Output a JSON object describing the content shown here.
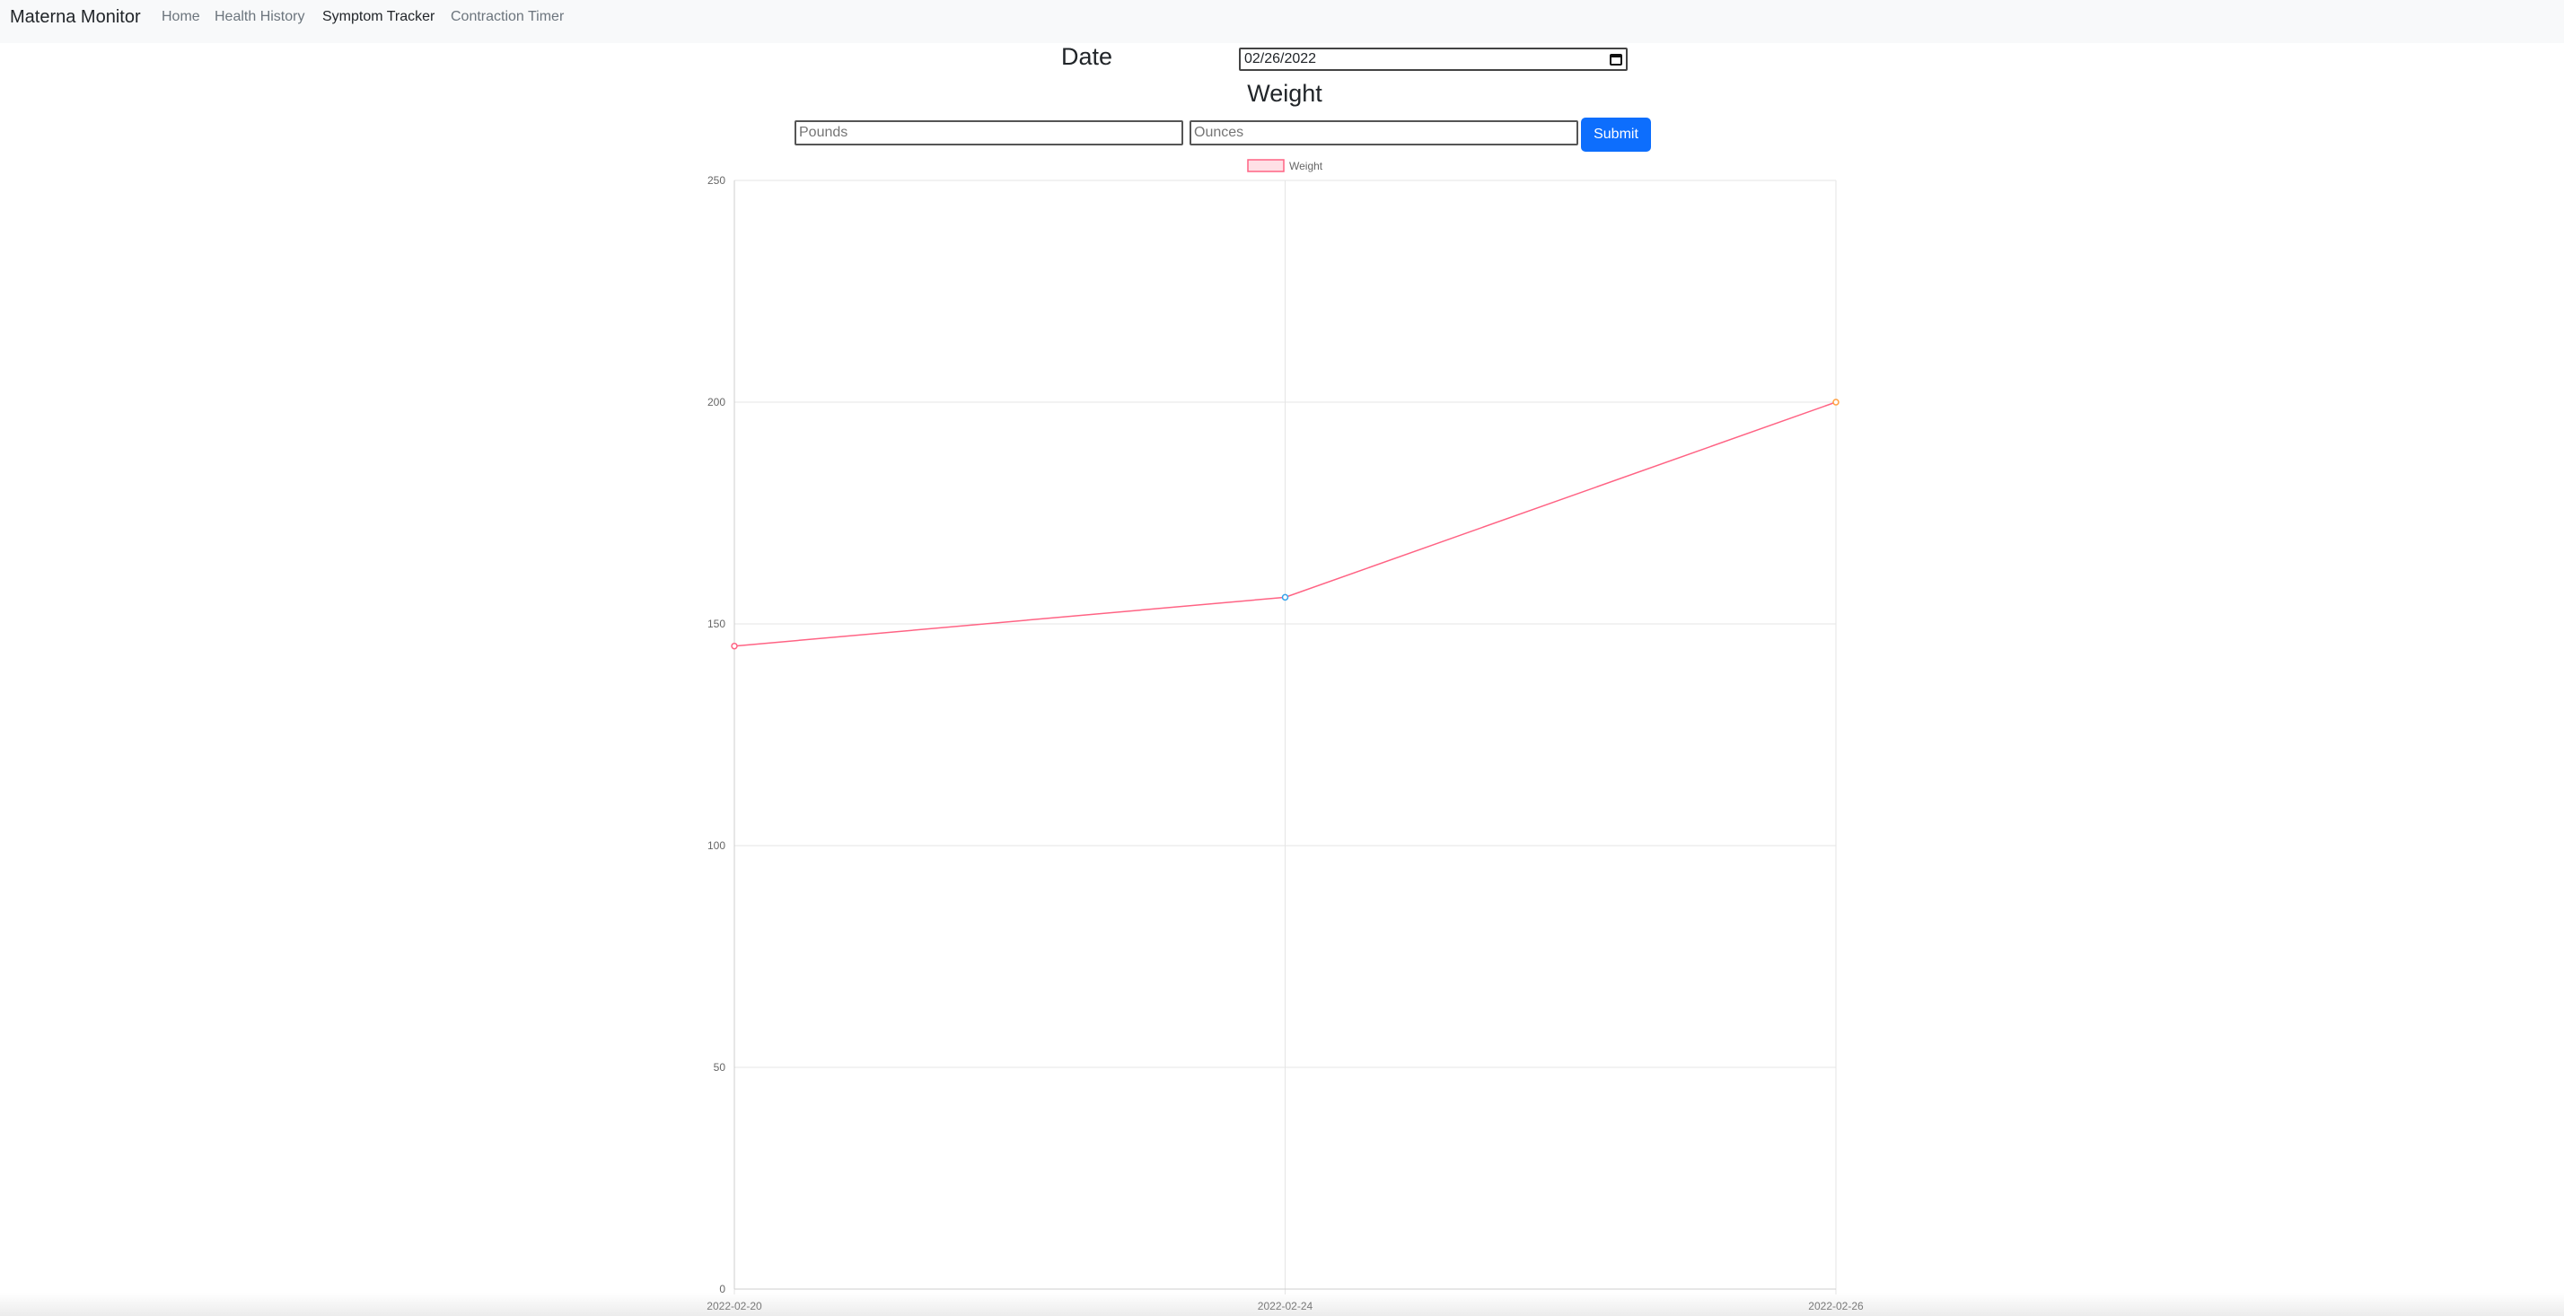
{
  "navbar": {
    "brand": "Materna Monitor",
    "links": [
      {
        "label": "Home",
        "active": false
      },
      {
        "label": "Health History",
        "active": false
      },
      {
        "label": "Symptom Tracker",
        "active": true
      },
      {
        "label": "Contraction Timer",
        "active": false
      }
    ]
  },
  "form": {
    "date_label": "Date",
    "date_value": "02/26/2022",
    "weight_heading": "Weight",
    "pounds_placeholder": "Pounds",
    "ounces_placeholder": "Ounces",
    "submit_label": "Submit"
  },
  "colors": {
    "line": "#ff6384",
    "legend_fill": "#ffe0e6",
    "grid": "#e5e5e5",
    "point_colors": [
      "#ff6384",
      "#36a2eb",
      "#ff9f40"
    ],
    "primary": "#0d6efd"
  },
  "chart_data": {
    "type": "line",
    "legend": "Weight",
    "legend_position": "top",
    "x": [
      "2022-02-20",
      "2022-02-24",
      "2022-02-26"
    ],
    "series": [
      {
        "name": "Weight",
        "values": [
          145,
          156,
          200
        ]
      }
    ],
    "ylim": [
      0,
      250
    ],
    "yticks": [
      0,
      50,
      100,
      150,
      200,
      250
    ],
    "grid": true
  }
}
